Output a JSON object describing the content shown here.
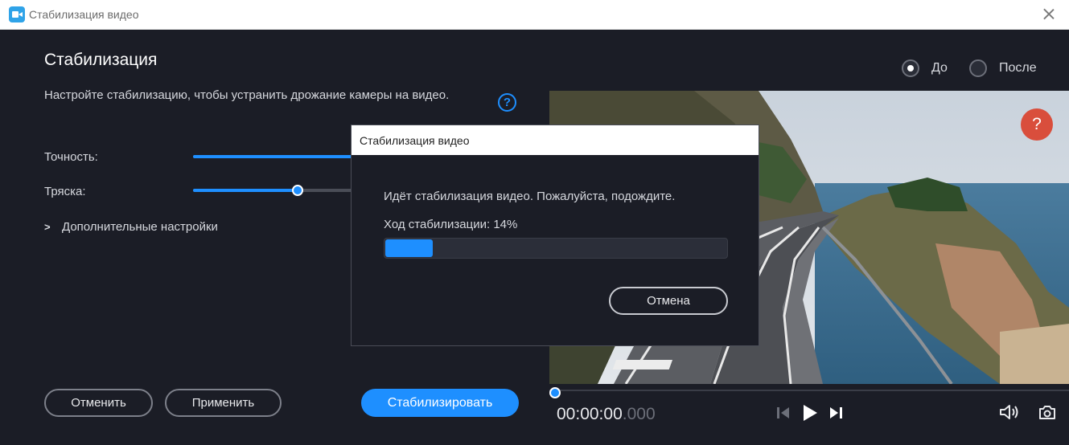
{
  "window": {
    "title": "Стабилизация видео",
    "app_icon": "video-camera-icon"
  },
  "left_panel": {
    "heading": "Стабилизация",
    "description": "Настройте стабилизацию, чтобы устранить дрожание камеры на видео.",
    "help": "?",
    "accuracy_label": "Точность:",
    "accuracy_level": 0.6,
    "shake_label": "Тряска:",
    "shake_level": 0.35,
    "advanced_chevron": ">",
    "advanced_label": "Дополнительные настройки",
    "cancel_label": "Отменить",
    "apply_label": "Применить",
    "stabilize_label": "Стабилизировать"
  },
  "compare": {
    "before_label": "До",
    "after_label": "После",
    "selected": "before"
  },
  "preview": {
    "help": "?"
  },
  "player": {
    "time_main": "00:00:00",
    "time_ms": ".000",
    "position": 0.0
  },
  "dialog": {
    "title": "Стабилизация видео",
    "message": "Идёт стабилизация видео. Пожалуйста, подождите.",
    "progress_label": "Ход стабилизации: 14%",
    "progress": 0.14,
    "cancel_label": "Отмена"
  },
  "colors": {
    "accent": "#1e8fff",
    "background": "#1b1d26",
    "help_red": "#d94e3c"
  }
}
